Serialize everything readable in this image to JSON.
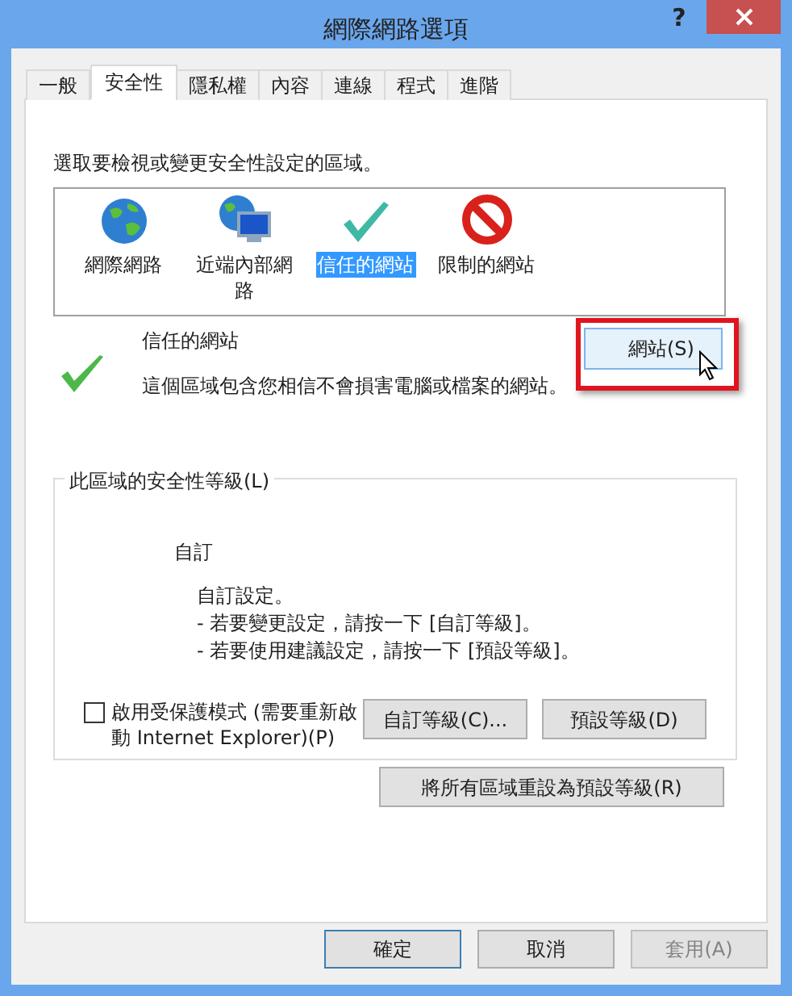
{
  "window": {
    "title": "網際網路選項",
    "help": "?"
  },
  "tabs": [
    {
      "label": "一般",
      "selected": false
    },
    {
      "label": "安全性",
      "selected": true
    },
    {
      "label": "隱私權",
      "selected": false
    },
    {
      "label": "內容",
      "selected": false
    },
    {
      "label": "連線",
      "selected": false
    },
    {
      "label": "程式",
      "selected": false
    },
    {
      "label": "進階",
      "selected": false
    }
  ],
  "zones": {
    "prompt": "選取要檢視或變更安全性設定的區域。",
    "items": [
      {
        "label": "網際網路",
        "kind": "globe",
        "selected": false
      },
      {
        "label": "近端內部網路",
        "kind": "intranet",
        "selected": false
      },
      {
        "label": "信任的網站",
        "kind": "trusted",
        "selected": true
      },
      {
        "label": "限制的網站",
        "kind": "restricted",
        "selected": false
      }
    ]
  },
  "zone_info": {
    "title": "信任的網站",
    "description": "這個區域包含您相信不會損害電腦或檔案的網站。",
    "sites_button": {
      "label": "網站(S)",
      "highlighted": true
    }
  },
  "security_level": {
    "legend": "此區域的安全性等級(L)",
    "level_name": "自訂",
    "lines": [
      "自訂設定。",
      "- 若要變更設定，請按一下 [自訂等級]。",
      "- 若要使用建議設定，請按一下 [預設等級]。"
    ],
    "protected_mode": {
      "label": "啟用受保護模式 (需要重新啟動 Internet Explorer)(P)",
      "checked": false
    },
    "buttons": [
      "自訂等級(C)...",
      "預設等級(D)"
    ]
  },
  "reset_button": "將所有區域重設為預設等級(R)",
  "footer_buttons": [
    {
      "label": "確定",
      "default": true,
      "disabled": false
    },
    {
      "label": "取消",
      "default": false,
      "disabled": false
    },
    {
      "label": "套用(A)",
      "default": false,
      "disabled": true
    }
  ]
}
